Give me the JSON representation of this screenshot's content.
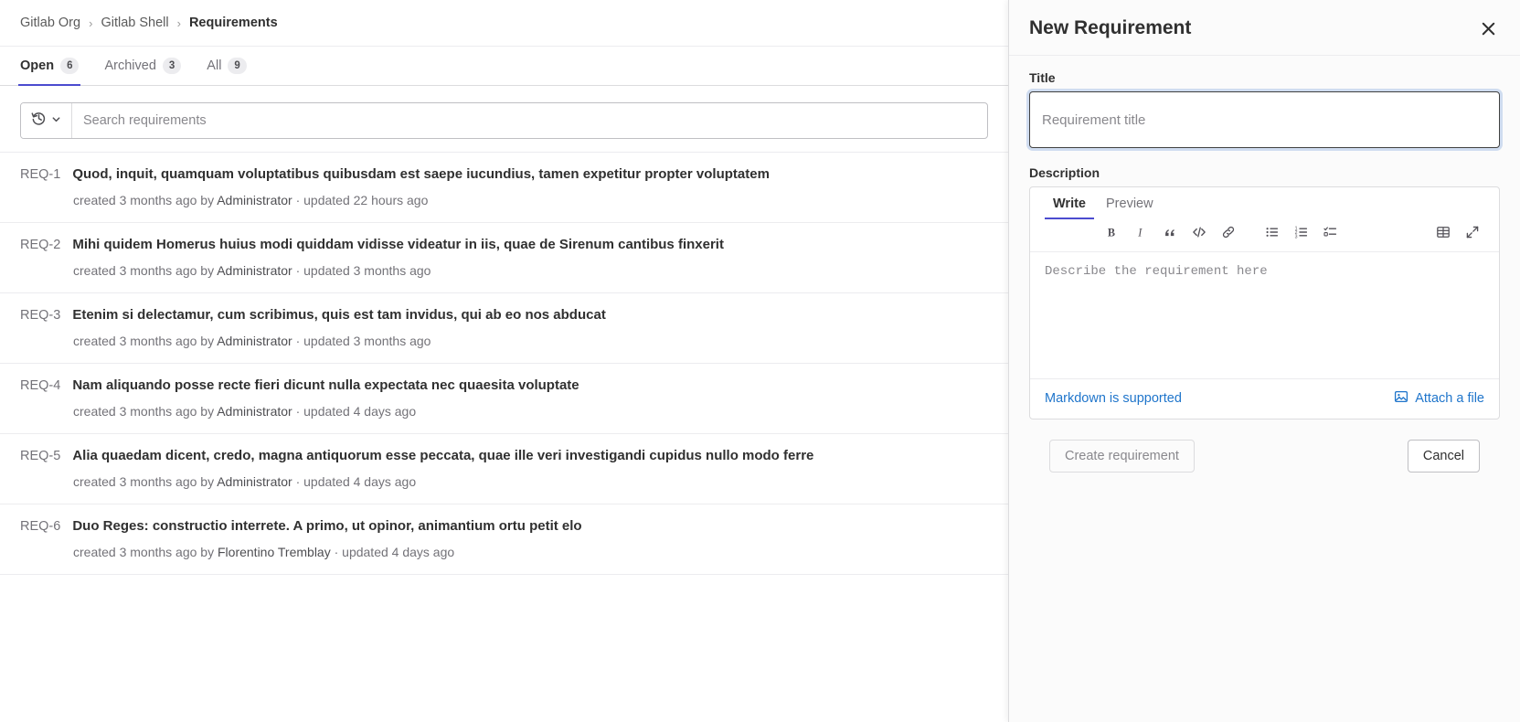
{
  "breadcrumb": {
    "items": [
      {
        "label": "Gitlab Org",
        "current": false
      },
      {
        "label": "Gitlab Shell",
        "current": false
      },
      {
        "label": "Requirements",
        "current": true
      }
    ],
    "separator": "›"
  },
  "tabs": [
    {
      "label": "Open",
      "count": "6",
      "active": true
    },
    {
      "label": "Archived",
      "count": "3",
      "active": false
    },
    {
      "label": "All",
      "count": "9",
      "active": false
    }
  ],
  "search": {
    "placeholder": "Search requirements",
    "history_icon": "history-icon",
    "chevron_icon": "chevron-down-icon"
  },
  "requirements": [
    {
      "id": "REQ-1",
      "title": "Quod, inquit, quamquam voluptatibus quibusdam est saepe iucundius, tamen expetitur propter voluptatem",
      "created": "created 3 months ago by ",
      "author": "Administrator",
      "updated": " · updated 22 hours ago"
    },
    {
      "id": "REQ-2",
      "title": "Mihi quidem Homerus huius modi quiddam vidisse videatur in iis, quae de Sirenum cantibus finxerit",
      "created": "created 3 months ago by ",
      "author": "Administrator",
      "updated": " · updated 3 months ago"
    },
    {
      "id": "REQ-3",
      "title": "Etenim si delectamur, cum scribimus, quis est tam invidus, qui ab eo nos abducat",
      "created": "created 3 months ago by ",
      "author": "Administrator",
      "updated": " · updated 3 months ago"
    },
    {
      "id": "REQ-4",
      "title": "Nam aliquando posse recte fieri dicunt nulla expectata nec quaesita voluptate",
      "created": "created 3 months ago by ",
      "author": "Administrator",
      "updated": " · updated 4 days ago"
    },
    {
      "id": "REQ-5",
      "title": "Alia quaedam dicent, credo, magna antiquorum esse peccata, quae ille veri investigandi cupidus nullo modo ferre",
      "created": "created 3 months ago by ",
      "author": "Administrator",
      "updated": " · updated 4 days ago"
    },
    {
      "id": "REQ-6",
      "title": "Duo Reges: constructio interrete. A primo, ut opinor, animantium ortu petit elo",
      "created": "created 3 months ago by ",
      "author": "Florentino Tremblay",
      "updated": " · updated 4 days ago"
    }
  ],
  "drawer": {
    "title": "New Requirement",
    "close_icon": "close-icon",
    "title_field": {
      "label": "Title",
      "placeholder": "Requirement title",
      "value": "",
      "focused": true
    },
    "description_field": {
      "label": "Description",
      "placeholder": "Describe the requirement here",
      "value": "",
      "tabs": [
        {
          "label": "Write",
          "active": true
        },
        {
          "label": "Preview",
          "active": false
        }
      ],
      "toolbar": [
        {
          "name": "bold-icon",
          "glyph": "B"
        },
        {
          "name": "italic-icon",
          "glyph": "I"
        },
        {
          "name": "quote-icon",
          "glyph": "”"
        },
        {
          "name": "code-icon",
          "glyph": "</>"
        },
        {
          "name": "link-icon",
          "glyph": "🔗"
        },
        {
          "name": "bullet-list-icon",
          "glyph": ""
        },
        {
          "name": "numbered-list-icon",
          "glyph": ""
        },
        {
          "name": "task-list-icon",
          "glyph": ""
        },
        {
          "name": "table-icon",
          "glyph": ""
        },
        {
          "name": "fullscreen-icon",
          "glyph": ""
        }
      ],
      "markdown_link": "Markdown is supported",
      "attach_label": "Attach a file",
      "attach_icon": "image-icon"
    },
    "actions": {
      "create_label": "Create requirement",
      "create_disabled": true,
      "cancel_label": "Cancel"
    }
  },
  "colors": {
    "accent": "#4b4bcf",
    "link": "#1f75cb",
    "focus_ring": "#cfdcf0",
    "border": "#dcdcde",
    "text": "#303030",
    "muted": "#737278"
  }
}
